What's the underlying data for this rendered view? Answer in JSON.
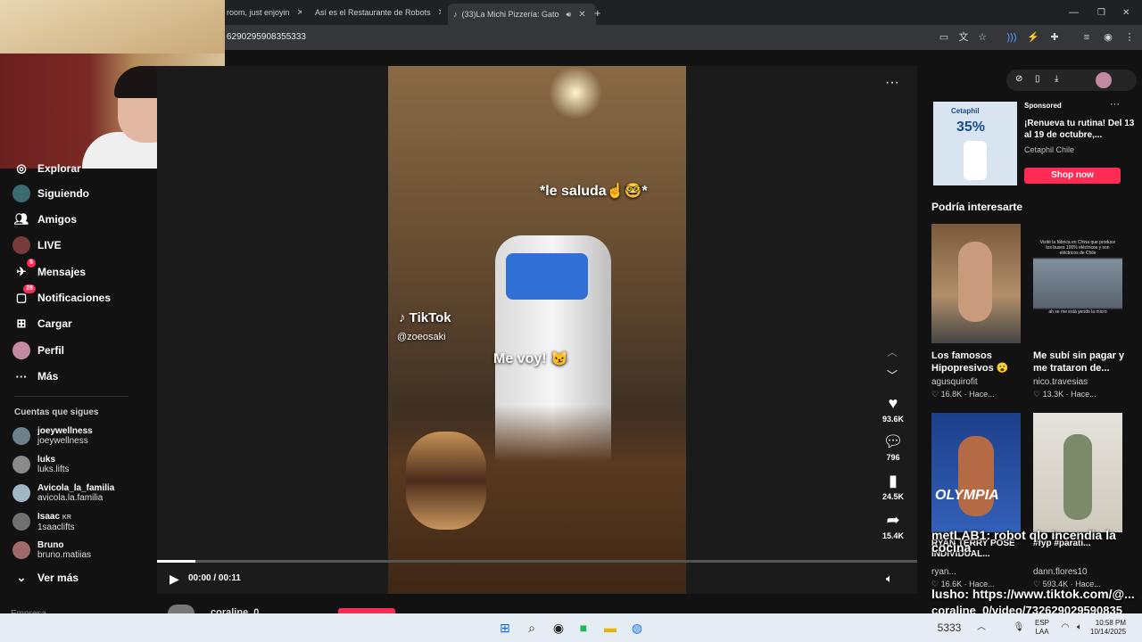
{
  "browser": {
    "tabs": [
      {
        "label": "room, just enjoyin"
      },
      {
        "label": "Así es el Restaurante de Robots"
      },
      {
        "label": "(33)La Michi Pizzería: Gato"
      }
    ],
    "new_tab": "+",
    "url": "6290295908355333"
  },
  "nav": {
    "items": [
      {
        "label": "Explorar",
        "icon": "compass-icon"
      },
      {
        "label": "Siguiendo",
        "icon": "following-icon"
      },
      {
        "label": "Amigos",
        "icon": "friends-icon"
      },
      {
        "label": "LIVE",
        "icon": "live-icon"
      },
      {
        "label": "Mensajes",
        "icon": "messages-icon",
        "badge": "5"
      },
      {
        "label": "Notificaciones",
        "icon": "notifications-icon",
        "badge": "28"
      },
      {
        "label": "Cargar",
        "icon": "upload-icon"
      },
      {
        "label": "Perfil",
        "icon": "profile-icon"
      },
      {
        "label": "Más",
        "icon": "more-icon"
      }
    ],
    "following_title": "Cuentas que sigues",
    "following": [
      {
        "name": "joeywellness",
        "handle": "joeywellness"
      },
      {
        "name": "luks",
        "handle": "luks.lifts"
      },
      {
        "name": "Avicola_la_familia",
        "handle": "avicola.la.familia"
      },
      {
        "name": "Isaac",
        "badge": "KR",
        "handle": "1saaclifts"
      },
      {
        "name": "Bruno",
        "handle": "bruno.matiias"
      }
    ],
    "see_more": "Ver más",
    "footer_partial": "Empresa"
  },
  "video": {
    "caption_top": "*le saluda☝️🤓*",
    "caption_mid": "Me voy! 😼",
    "watermark": "TikTok",
    "watermark_user": "@zoeosaki",
    "time": "00:00 / 00:11",
    "progress_fraction": 0.05,
    "author_partial": "coraline_0",
    "actions": [
      {
        "icon": "heart-icon",
        "count": "93.6K"
      },
      {
        "icon": "comment-icon",
        "count": "796"
      },
      {
        "icon": "bookmark-icon",
        "count": "24.5K"
      },
      {
        "icon": "share-icon",
        "count": "15.4K"
      }
    ]
  },
  "sponsored": {
    "label": "Sponsored",
    "title": "¡Renueva tu rutina! Del 13 al 19 de octubre,...",
    "advertiser": "Cetaphil Chile",
    "cta": "Shop now",
    "thumb_brand": "Cetaphil",
    "thumb_offer": "35%"
  },
  "suggest": {
    "title": "Podría interesarte",
    "cards": [
      {
        "title": "Los famosos Hipopresivos 😮",
        "user": "agusquirofit",
        "likes": "16.8K",
        "time": "Hace..."
      },
      {
        "title": "Me subí sin pagar y me trataron de...",
        "user": "nico.travesias",
        "likes": "13.3K",
        "time": "Hace...",
        "thumb_top_text": "Visité la fábrica en China que produce los buses 100% eléctricos y son eléctricos de Chile",
        "thumb_bottom_text": "ah se me está yendo la micro"
      },
      {
        "title": "RYAN TERRY POSE INDIVIDUAL...",
        "user": "ryan...",
        "likes": "16.6K",
        "time": "Hace...",
        "thumb_text": "OLYMPIA"
      },
      {
        "title": "#fyp #parati...",
        "user": "dann.flores10",
        "likes": "593.4K",
        "time": "Hace..."
      }
    ]
  },
  "stream_overlay": {
    "line1": "metLAB1: robot qlo incendia la cocina",
    "line2": "lusho: https://www.tiktok.com/@...",
    "line3": "coraline_0/video/732629029590835",
    "line4": "5333"
  },
  "taskbar": {
    "lang1": "ESP",
    "lang2": "LAA",
    "time": "10:58 PM",
    "date": "10/14/2025"
  },
  "colors": {
    "accent": "#fe2c55",
    "bg": "#121212"
  }
}
